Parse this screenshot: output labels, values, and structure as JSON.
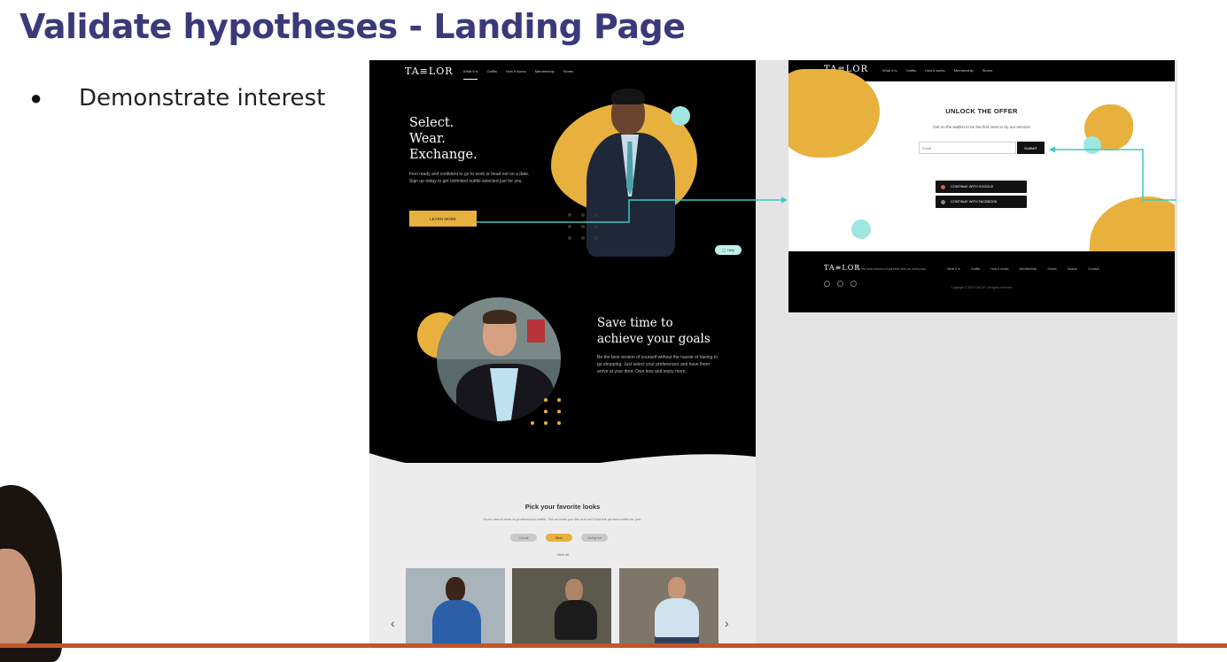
{
  "slide": {
    "title": "Validate hypotheses - Landing Page",
    "bullets": [
      "Demonstrate interest"
    ]
  },
  "brand": {
    "logo": "TA≡LOR",
    "accent": "#e8b13d",
    "teal": "#3ec7c2",
    "title_color": "#3a3a7a"
  },
  "landing": {
    "nav": [
      "What it is",
      "Outfits",
      "How it works",
      "Membership",
      "Stores"
    ],
    "hero": {
      "title_lines": [
        "Select.",
        "Wear.",
        "Exchange."
      ],
      "subtitle": "Feel ready and confident to go to work or head out on a date. Sign up today to get unlimited outfits selected just for you.",
      "button": "LEARN MORE"
    },
    "chat": "Help",
    "save": {
      "title_lines": [
        "Save time to",
        "achieve your goals"
      ],
      "body": "Be the best version of yourself without the hassle of having to go shopping. Just select your preferences and have them arrive at your door. Own less and enjoy more."
    },
    "looks": {
      "title": "Pick your favorite looks",
      "subtitle": "From casual wear to professional outfits. Tell us what you like and we'll find the perfect outfits for you.",
      "chips": [
        "Casual",
        "Work",
        "Going out"
      ],
      "view_all": "View all",
      "prev_arrow": "‹",
      "next_arrow": "›"
    }
  },
  "offer": {
    "nav": [
      "What it is",
      "Outfits",
      "How it works",
      "Membership",
      "Stores"
    ],
    "title": "UNLOCK THE OFFER",
    "subtitle": "Get on the waitlist to be the first ones to try our service!",
    "email_placeholder": "Email",
    "submit": "SUBMIT",
    "google": "CONTINUE WITH GOOGLE",
    "facebook": "CONTINUE WITH FACEBOOK",
    "footer": {
      "tagline": "Be the best version of yourself with us, every day",
      "links": [
        "What it is",
        "Outfits",
        "How it works",
        "Membership",
        "Stores",
        "Search",
        "Contact"
      ],
      "copyright": "Copyright © 2020 TAILOR. All rights reserved."
    }
  }
}
